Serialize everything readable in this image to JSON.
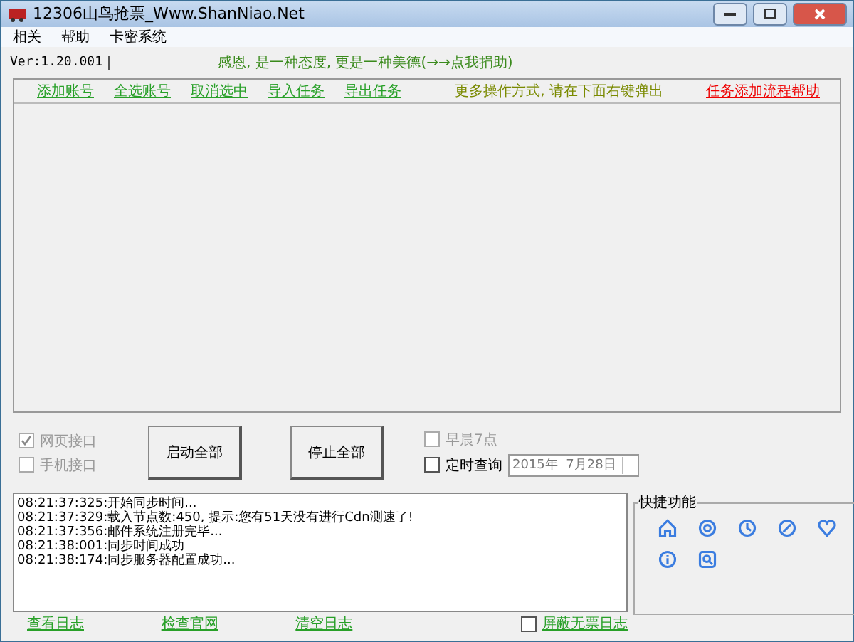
{
  "window": {
    "title": "12306山鸟抢票_Www.ShanNiao.Net"
  },
  "menu": [
    "相关",
    "帮助",
    "卡密系统"
  ],
  "version": "Ver:1.20.001",
  "slogan": "感恩, 是一种态度, 更是一种美德(→→点我捐助)",
  "task_links": [
    {
      "label": "添加账号",
      "kind": "link"
    },
    {
      "label": "全选账号",
      "kind": "link"
    },
    {
      "label": "取消选中",
      "kind": "link"
    },
    {
      "label": "导入任务",
      "kind": "link"
    },
    {
      "label": "导出任务",
      "kind": "link"
    },
    {
      "label": "更多操作方式, 请在下面右键弹出",
      "kind": "hint"
    },
    {
      "label": "任务添加流程帮助",
      "kind": "help"
    }
  ],
  "interfaces": [
    {
      "label": "网页接口",
      "checked": true,
      "disabled": true
    },
    {
      "label": "手机接口",
      "checked": false,
      "disabled": true
    }
  ],
  "buttons": [
    "启动全部",
    "停止全部"
  ],
  "schedule": [
    {
      "label": "早晨7点",
      "checked": false,
      "disabled": true
    },
    {
      "label": "定时查询",
      "checked": false,
      "disabled": false
    }
  ],
  "date_field": {
    "value": "2015年  7月28日"
  },
  "log": [
    "08:21:37:325:开始同步时间...",
    "08:21:37:329:载入节点数:450, 提示:您有51天没有进行Cdn测速了!",
    "08:21:37:356:邮件系统注册完毕...",
    "08:21:38:001:同步时间成功",
    "08:21:38:174:同步服务器配置成功..."
  ],
  "log_links": [
    {
      "label": "查看日志"
    },
    {
      "label": "检查官网"
    },
    {
      "label": "清空日志"
    }
  ],
  "hide_log": {
    "label": "屏蔽无票日志",
    "checked": false
  },
  "quick": {
    "title": "快捷功能"
  }
}
